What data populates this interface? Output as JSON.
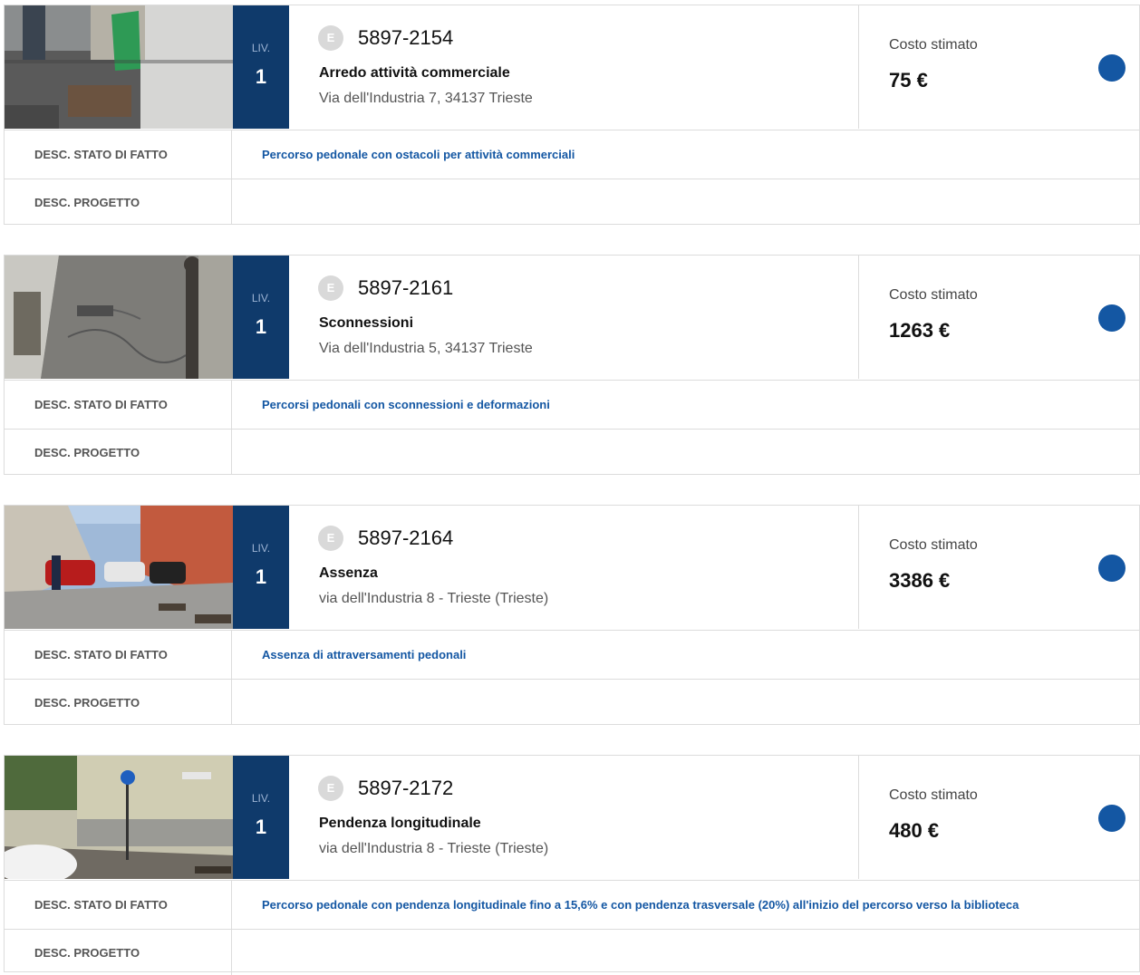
{
  "labels": {
    "level_label": "LIV.",
    "cost_label": "Costo stimato",
    "badge": "E",
    "desc_state": "DESC. STATO DI FATTO",
    "desc_project": "DESC. PROGETTO"
  },
  "colors": {
    "level_bg": "#0f3a6b",
    "accent": "#1457a3",
    "badge": "#d9d9d9"
  },
  "cards": [
    {
      "level": "1",
      "code": "5897-2154",
      "type": "Arredo attività commerciale",
      "address": "Via dell'Industria 7, 34137 Trieste",
      "cost": "75 €",
      "state_desc": "Percorso pedonale con ostacoli per attività commerciali",
      "project_desc": ""
    },
    {
      "level": "1",
      "code": "5897-2161",
      "type": "Sconnessioni",
      "address": "Via dell'Industria 5, 34137 Trieste",
      "cost": "1263 €",
      "state_desc": "Percorsi pedonali con sconnessioni e deformazioni",
      "project_desc": ""
    },
    {
      "level": "1",
      "code": "5897-2164",
      "type": "Assenza",
      "address": "via dell'Industria 8 - Trieste (Trieste)",
      "cost": "3386 €",
      "state_desc": "Assenza di attraversamenti pedonali",
      "project_desc": ""
    },
    {
      "level": "1",
      "code": "5897-2172",
      "type": "Pendenza longitudinale",
      "address": "via dell'Industria 8 - Trieste (Trieste)",
      "cost": "480 €",
      "state_desc": "Percorso pedonale con pendenza longitudinale fino a 15,6% e con pendenza trasversale (20%) all'inizio del percorso verso la biblioteca",
      "project_desc": ""
    }
  ]
}
